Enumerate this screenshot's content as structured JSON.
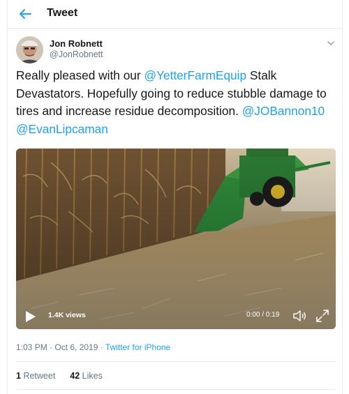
{
  "header": {
    "title": "Tweet",
    "back_icon": "arrow-left-icon"
  },
  "author": {
    "name": "Jon Robnett",
    "handle": "@JonRobnett"
  },
  "tweet": {
    "segments": [
      {
        "text": "Really pleased with our ",
        "type": "text"
      },
      {
        "text": "@YetterFarmEquip",
        "type": "mention"
      },
      {
        "text": " Stalk Devastators.  Hopefully going to reduce stubble damage to tires and increase residue decomposition. ",
        "type": "text"
      },
      {
        "text": "@JOBannon10",
        "type": "mention"
      },
      {
        "text": " ",
        "type": "text"
      },
      {
        "text": "@EvanLipcaman",
        "type": "mention"
      }
    ]
  },
  "media": {
    "views": "1.4K views",
    "time": "0:00 / 0:19",
    "icons": [
      "play-icon",
      "volume-icon",
      "fullscreen-icon"
    ]
  },
  "meta": {
    "timestamp": "1:03 PM · Oct 6, 2019",
    "separator": " · ",
    "source": "Twitter for iPhone"
  },
  "stats": {
    "retweets_count": "1",
    "retweets_label": "Retweet",
    "likes_count": "42",
    "likes_label": "Likes"
  },
  "colors": {
    "accent": "#1da1f2",
    "muted": "#657786",
    "border": "#e6ecf0"
  }
}
